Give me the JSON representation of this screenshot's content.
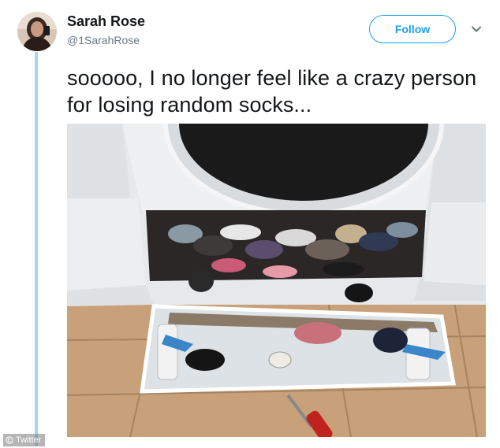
{
  "tweet": {
    "author_name": "Sarah Rose",
    "author_handle": "@1SarahRose",
    "follow_label": "Follow",
    "text": "sooooo, I no longer feel like a crazy person for losing random socks..."
  },
  "watermark": {
    "label": "Twitter"
  },
  "colors": {
    "accent": "#1da1f2",
    "thread_line": "#9ed9f7",
    "text_primary": "#14171a",
    "text_secondary": "#657786"
  },
  "icons": {
    "menu": "chevron-down-icon",
    "watermark": "copyright-icon"
  }
}
